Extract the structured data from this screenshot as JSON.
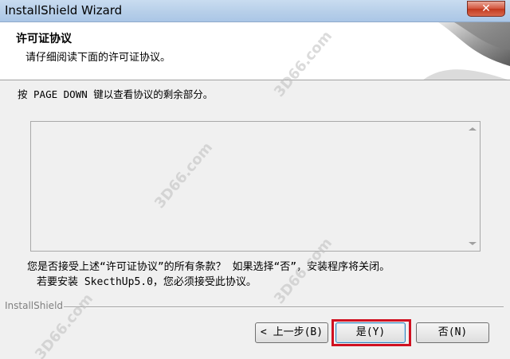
{
  "window": {
    "title": "InstallShield Wizard",
    "close_label": "✕"
  },
  "header": {
    "title": "许可证协议",
    "subtitle": "请仔细阅读下面的许可证协议。"
  },
  "instruction": "按 PAGE DOWN 键以查看协议的剩余部分。",
  "license_text": "",
  "question": {
    "line1": "您是否接受上述“许可证协议”的所有条款？  如果选择“否”，安装程序将关闭。",
    "line2": "若要安装 SkecthUp5.0，您必须接受此协议。"
  },
  "footer": {
    "brand": "InstallShield"
  },
  "buttons": {
    "back": "< 上一步(B)",
    "yes": "是(Y)",
    "no": "否(N)"
  },
  "watermarks": [
    "3D66.com",
    "3D66.com",
    "3D66.com",
    "3D66.com"
  ],
  "colors": {
    "highlight": "#d01020",
    "titlebar": "#b7cfe9"
  }
}
